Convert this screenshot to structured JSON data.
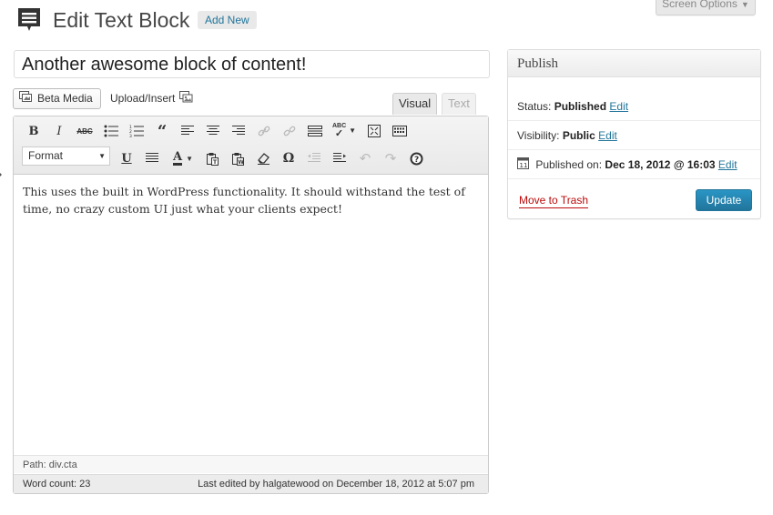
{
  "header": {
    "title": "Edit Text Block",
    "add_new_label": "Add New",
    "screen_options_label": "Screen Options"
  },
  "post": {
    "title_value": "Another awesome block of content!"
  },
  "media": {
    "beta_media_label": "Beta Media",
    "upload_insert_label": "Upload/Insert"
  },
  "editor": {
    "tabs": [
      {
        "label": "Visual",
        "active": true
      },
      {
        "label": "Text",
        "active": false
      }
    ],
    "format_select_value": "Format",
    "content": "This uses the built in WordPress functionality. It should withstand the test of time, no crazy custom UI just what your clients expect!",
    "path": "Path: div.cta",
    "word_count": "Word count: 23",
    "last_edited": "Last edited by halgatewood on December 18, 2012 at 5:07 pm",
    "toolbar_row1": [
      "bold-icon",
      "italic-icon",
      "strikethrough-icon",
      "bullet-list-icon",
      "numbered-list-icon",
      "blockquote-icon",
      "align-left-icon",
      "align-center-icon",
      "align-right-icon",
      "insert-link-icon",
      "remove-link-icon",
      "more-tag-icon",
      "spellcheck-icon",
      "fullscreen-icon",
      "kitchen-sink-icon"
    ],
    "toolbar_row2": [
      "underline-icon",
      "justify-icon",
      "text-color-icon",
      "paste-text-icon",
      "paste-word-icon",
      "clear-formatting-icon",
      "special-char-icon",
      "outdent-icon",
      "indent-icon",
      "undo-icon",
      "redo-icon",
      "help-icon"
    ]
  },
  "publish": {
    "heading": "Publish",
    "status_label": "Status:",
    "status_value": "Published",
    "visibility_label": "Visibility:",
    "visibility_value": "Public",
    "published_label": "Published on:",
    "published_value": "Dec 18, 2012 @ 16:03",
    "edit_label": "Edit",
    "trash_label": "Move to Trash",
    "update_label": "Update"
  },
  "colors": {
    "link": "#21759b",
    "trash": "#bc0b0b",
    "primary_button": "#21759b"
  }
}
